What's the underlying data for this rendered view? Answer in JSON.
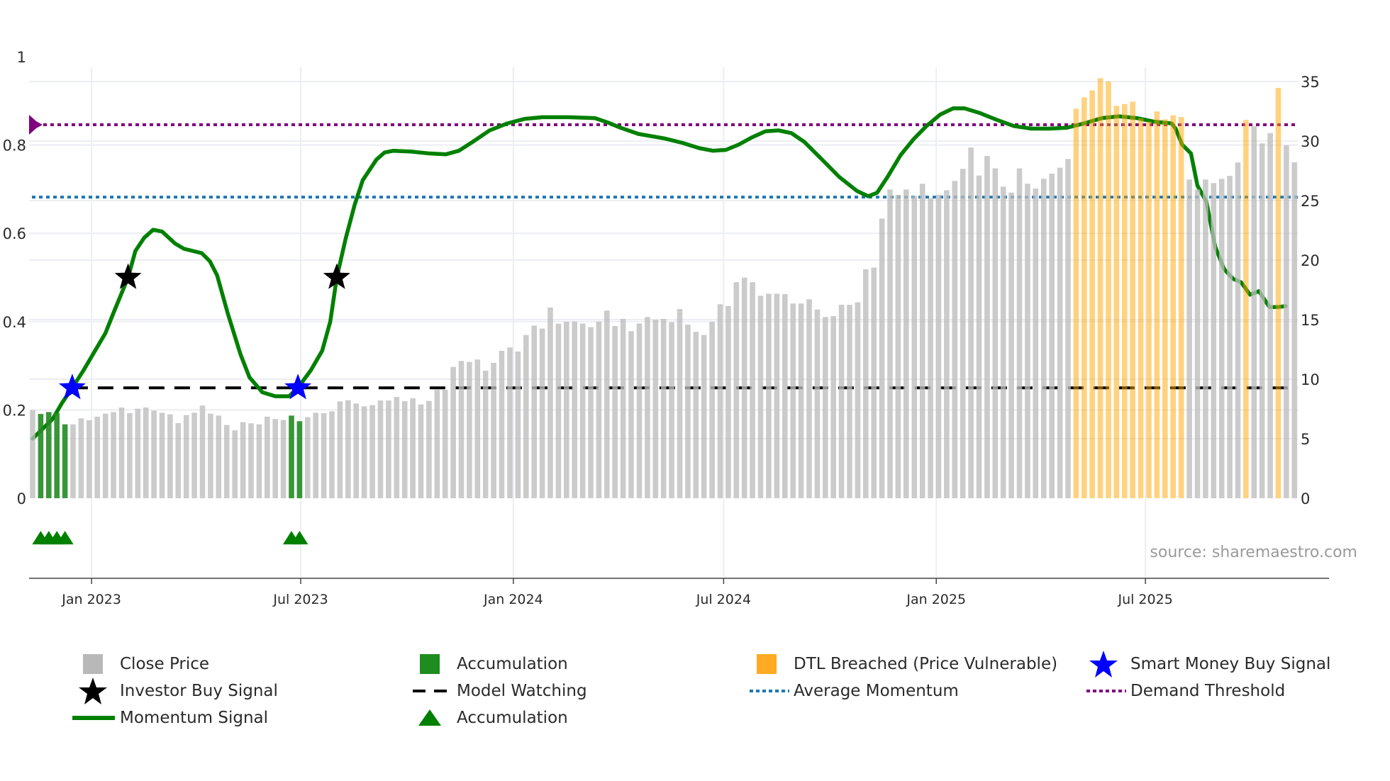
{
  "chart_data": {
    "type": "bar+line",
    "title": "",
    "source": "source: sharemaestro.com",
    "left_axis": {
      "range": [
        0,
        1
      ],
      "ticks": [
        "0",
        "0.2",
        "0.4",
        "0.6",
        "0.8",
        "1"
      ],
      "tick_values": [
        0,
        0.2,
        0.4,
        0.6,
        0.8,
        1
      ]
    },
    "right_axis": {
      "range": [
        0,
        35
      ],
      "ticks": [
        "0",
        "5",
        "10",
        "15",
        "20",
        "25",
        "30",
        "35"
      ],
      "tick_values": [
        0,
        5,
        10,
        15,
        20,
        25,
        30,
        35
      ]
    },
    "x_axis": {
      "start_date": "2022-11-11",
      "interval_days": 7,
      "ticks": [
        {
          "label": "Jan 2023",
          "date": "2023-01-01"
        },
        {
          "label": "Jul 2023",
          "date": "2023-07-01"
        },
        {
          "label": "Jan 2024",
          "date": "2024-01-01"
        },
        {
          "label": "Jul 2024",
          "date": "2024-07-01"
        },
        {
          "label": "Jan 2025",
          "date": "2025-01-01"
        },
        {
          "label": "Jul 2025",
          "date": "2025-07-01"
        }
      ]
    },
    "close_price": [
      7.4,
      7.08,
      7.24,
      7.16,
      6.21,
      6.21,
      6.71,
      6.55,
      6.85,
      7.1,
      7.24,
      7.62,
      7.14,
      7.52,
      7.62,
      7.36,
      7.18,
      7.04,
      6.31,
      6.98,
      7.18,
      7.78,
      7.1,
      6.94,
      6.15,
      5.71,
      6.39,
      6.29,
      6.21,
      6.85,
      6.65,
      6.57,
      6.94,
      6.47,
      6.81,
      7.18,
      7.14,
      7.3,
      8.13,
      8.23,
      7.95,
      7.72,
      7.82,
      8.21,
      8.21,
      8.51,
      8.15,
      8.39,
      7.88,
      8.17,
      9.11,
      9.11,
      11.03,
      11.53,
      11.45,
      11.65,
      10.71,
      11.37,
      12.38,
      12.66,
      12.32,
      13.71,
      14.5,
      14.25,
      16.01,
      14.66,
      14.82,
      14.84,
      14.67,
      14.37,
      14.84,
      15.76,
      14.46,
      15.06,
      14.03,
      14.67,
      15.22,
      15.0,
      15.06,
      14.78,
      15.89,
      14.58,
      13.97,
      13.71,
      14.82,
      16.29,
      16.15,
      18.14,
      18.53,
      18.14,
      17.0,
      17.18,
      17.18,
      17.14,
      16.35,
      16.35,
      16.71,
      15.85,
      15.22,
      15.3,
      16.25,
      16.25,
      16.45,
      19.23,
      19.37,
      23.49,
      25.93,
      25.48,
      25.93,
      25.38,
      26.41,
      25.18,
      25.48,
      25.87,
      26.65,
      27.66,
      29.45,
      27.1,
      28.75,
      27.7,
      26.17,
      25.67,
      27.7,
      26.41,
      26.01,
      26.83,
      27.26,
      27.76,
      28.49,
      32.72,
      33.67,
      34.25,
      35.28,
      35.0,
      32.96,
      33.11,
      33.31,
      31.92,
      31.63,
      32.48,
      31.83,
      32.16,
      32.02,
      26.77,
      25.93,
      26.77,
      26.47,
      26.83,
      27.08,
      28.2,
      31.77,
      31.23,
      29.8,
      30.67,
      34.46,
      29.64,
      28.21
    ],
    "accumulation_weeks": [
      1,
      2,
      3,
      4,
      32,
      33
    ],
    "dtl_breached_weeks": [
      129,
      130,
      131,
      132,
      133,
      134,
      135,
      136,
      137,
      138,
      139,
      140,
      141,
      142,
      150,
      154
    ],
    "momentum_signal": [
      [
        0,
        0.135
      ],
      [
        2.5,
        0.18
      ],
      [
        3.6,
        0.215
      ],
      [
        4.9,
        0.25
      ],
      [
        6.3,
        0.29
      ],
      [
        9.0,
        0.374
      ],
      [
        10.0,
        0.42
      ],
      [
        11.8,
        0.5
      ],
      [
        12.7,
        0.56
      ],
      [
        13.8,
        0.59
      ],
      [
        14.9,
        0.608
      ],
      [
        16.0,
        0.604
      ],
      [
        17.6,
        0.577
      ],
      [
        18.7,
        0.565
      ],
      [
        20.9,
        0.555
      ],
      [
        21.9,
        0.537
      ],
      [
        22.8,
        0.505
      ],
      [
        24.1,
        0.42
      ],
      [
        25.7,
        0.326
      ],
      [
        26.8,
        0.274
      ],
      [
        28.4,
        0.24
      ],
      [
        30.0,
        0.231
      ],
      [
        31.7,
        0.231
      ],
      [
        32.8,
        0.25
      ],
      [
        34.4,
        0.29
      ],
      [
        35.8,
        0.334
      ],
      [
        36.8,
        0.4
      ],
      [
        37.6,
        0.5
      ],
      [
        38.7,
        0.588
      ],
      [
        39.8,
        0.664
      ],
      [
        40.8,
        0.72
      ],
      [
        42.5,
        0.767
      ],
      [
        43.5,
        0.783
      ],
      [
        44.6,
        0.787
      ],
      [
        46.8,
        0.785
      ],
      [
        48.9,
        0.781
      ],
      [
        51.1,
        0.779
      ],
      [
        52.7,
        0.787
      ],
      [
        54.4,
        0.807
      ],
      [
        56.5,
        0.833
      ],
      [
        58.7,
        0.849
      ],
      [
        60.8,
        0.859
      ],
      [
        63.0,
        0.863
      ],
      [
        66.2,
        0.863
      ],
      [
        69.5,
        0.861
      ],
      [
        71.1,
        0.851
      ],
      [
        72.7,
        0.839
      ],
      [
        74.9,
        0.825
      ],
      [
        78.1,
        0.815
      ],
      [
        80.3,
        0.805
      ],
      [
        82.4,
        0.793
      ],
      [
        84.1,
        0.787
      ],
      [
        85.7,
        0.789
      ],
      [
        87.3,
        0.801
      ],
      [
        88.9,
        0.817
      ],
      [
        90.6,
        0.831
      ],
      [
        92.2,
        0.833
      ],
      [
        93.8,
        0.827
      ],
      [
        95.4,
        0.807
      ],
      [
        97.6,
        0.767
      ],
      [
        99.7,
        0.728
      ],
      [
        101.9,
        0.696
      ],
      [
        103.3,
        0.684
      ],
      [
        104.4,
        0.692
      ],
      [
        105.7,
        0.728
      ],
      [
        107.3,
        0.777
      ],
      [
        108.9,
        0.813
      ],
      [
        110.5,
        0.843
      ],
      [
        112.2,
        0.869
      ],
      [
        113.8,
        0.883
      ],
      [
        115.2,
        0.883
      ],
      [
        117.0,
        0.873
      ],
      [
        119.2,
        0.857
      ],
      [
        121.3,
        0.843
      ],
      [
        123.5,
        0.837
      ],
      [
        125.7,
        0.837
      ],
      [
        127.8,
        0.839
      ],
      [
        130.0,
        0.849
      ],
      [
        132.2,
        0.861
      ],
      [
        134.3,
        0.865
      ],
      [
        136.5,
        0.861
      ],
      [
        138.6,
        0.853
      ],
      [
        140.8,
        0.849
      ],
      [
        141.3,
        0.837
      ],
      [
        142.1,
        0.801
      ],
      [
        143.2,
        0.781
      ],
      [
        144.0,
        0.708
      ],
      [
        145.1,
        0.672
      ],
      [
        146.2,
        0.569
      ],
      [
        147.3,
        0.519
      ],
      [
        148.4,
        0.497
      ],
      [
        149.4,
        0.489
      ],
      [
        150.5,
        0.461
      ],
      [
        151.6,
        0.469
      ],
      [
        152.9,
        0.433
      ],
      [
        154.0,
        0.433
      ],
      [
        154.9,
        0.435
      ]
    ],
    "investor_buy_signals": [
      [
        11.8,
        0.5
      ],
      [
        37.6,
        0.5
      ]
    ],
    "smart_money_buy_signals": [
      [
        4.9,
        0.25
      ],
      [
        32.8,
        0.25
      ]
    ],
    "accumulation_markers_value": -0.09,
    "model_watching": {
      "value": 0.25,
      "from_week": 4.9
    },
    "average_momentum": 0.682,
    "demand_threshold": 0.846,
    "colors": {
      "close": "#bdbdbd",
      "accumulation": "#228b22",
      "dtl": "#ffa500",
      "momentum": "#008000",
      "investor": "#000000",
      "smart_money": "#0000ff",
      "model_watching": "#000000",
      "avg_momentum": "#1f77b4",
      "demand": "#800080"
    },
    "legend": [
      {
        "label": "Close Price",
        "symbol": "square-gray"
      },
      {
        "label": "Accumulation",
        "symbol": "square-green"
      },
      {
        "label": "DTL Breached (Price Vulnerable)",
        "symbol": "square-orange"
      },
      {
        "label": "Smart Money Buy Signal",
        "symbol": "star-blue"
      },
      {
        "label": "Investor Buy Signal",
        "symbol": "star-black"
      },
      {
        "label": "Model Watching",
        "symbol": "dash-black"
      },
      {
        "label": "Average Momentum",
        "symbol": "dot-blue"
      },
      {
        "label": "Demand Threshold",
        "symbol": "dot-purple"
      },
      {
        "label": "Momentum Signal",
        "symbol": "line-green"
      },
      {
        "label": "Accumulation",
        "symbol": "triangle-green"
      }
    ]
  }
}
